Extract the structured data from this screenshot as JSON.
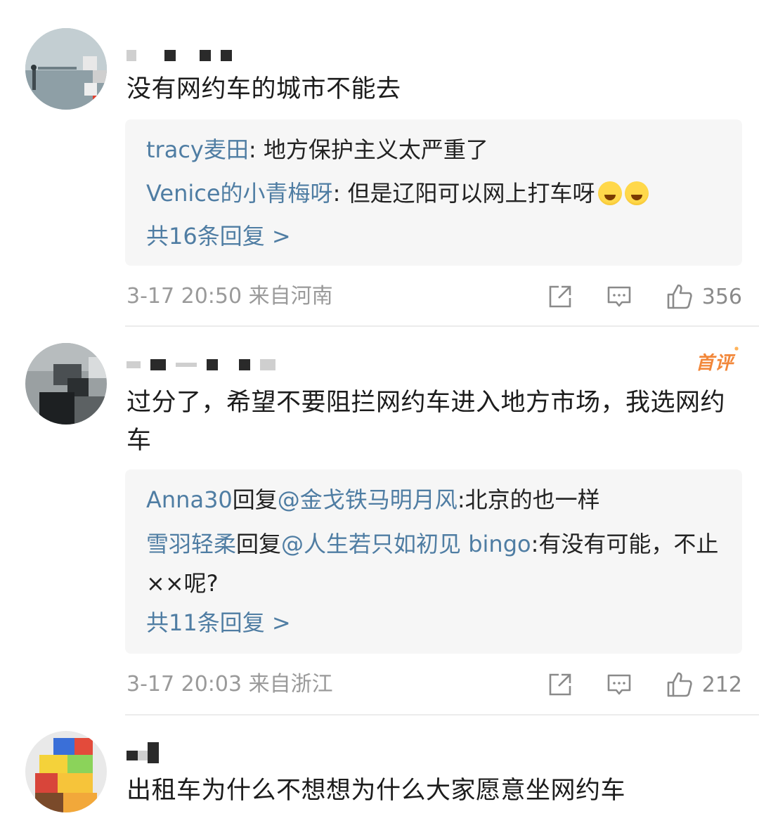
{
  "comments": [
    {
      "text": "没有网约车的城市不能去",
      "replies": [
        {
          "name": "tracy麦田",
          "sep": ": ",
          "content": "地方保护主义太严重了"
        },
        {
          "name": "Venice的小青梅呀",
          "sep": ": ",
          "content": "但是辽阳可以网上打车呀"
        }
      ],
      "more_replies": "共16条回复 >",
      "meta": "3-17 20:50 来自河南",
      "likes": "356",
      "reply_emojis": [
        "laughing-crying-emoji",
        "laughing-crying-emoji"
      ]
    },
    {
      "badge": "首评",
      "text": "过分了，希望不要阻拦网约车进入地方市场，我选网约车",
      "replies": [
        {
          "name": "Anna30",
          "mid": "回复",
          "at": "@金戈铁马明月风",
          "content": ":北京的也一样"
        },
        {
          "name": "雪羽轻柔",
          "mid": "回复",
          "at": "@人生若只如初见 bingo",
          "content": ":有没有可能，不止××呢?"
        }
      ],
      "more_replies": "共11条回复 >",
      "meta": "3-17 20:03 来自浙江",
      "likes": "212"
    },
    {
      "text": "出租车为什么不想想为什么大家愿意坐网约车"
    }
  ],
  "icons": {
    "share": "share-icon",
    "comment": "comment-icon",
    "like": "thumbs-up-icon"
  },
  "colors": {
    "link_blue": "#4f7da3",
    "meta_gray": "#9a9a9a",
    "badge_orange": "#f2873a",
    "reply_bg": "#f6f6f6"
  }
}
